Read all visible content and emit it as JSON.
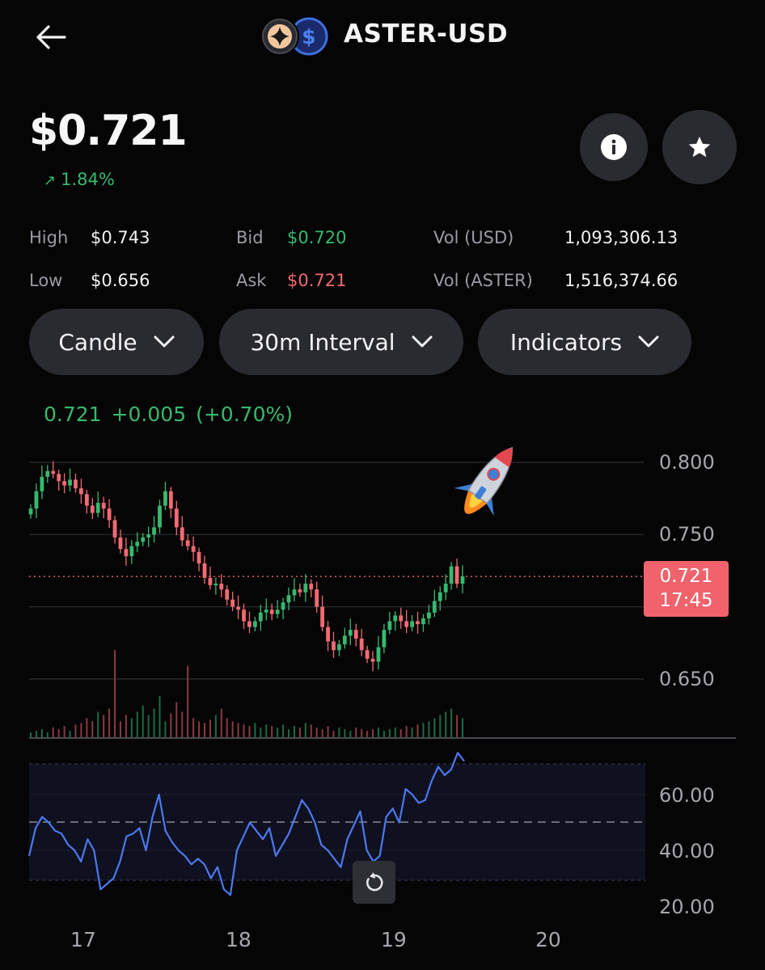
{
  "header": {
    "pair": "ASTER-USD",
    "back_icon": "arrow-left-icon",
    "coin_icons": [
      "aster-logo-icon",
      "usd-coin-icon"
    ]
  },
  "price": {
    "value": "$0.721",
    "change": "1.84%",
    "change_icon": "arrow-up-right-icon",
    "change_color": "#37b96e"
  },
  "actions": {
    "info_icon": "info-icon",
    "favorite_icon": "star-icon"
  },
  "stats": {
    "high_label": "High",
    "high_value": "$0.743",
    "low_label": "Low",
    "low_value": "$0.656",
    "bid_label": "Bid",
    "bid_value": "$0.720",
    "ask_label": "Ask",
    "ask_value": "$0.721",
    "vol_usd_label": "Vol (USD)",
    "vol_usd_value": "1,093,306.13",
    "vol_aster_label": "Vol (ASTER)",
    "vol_aster_value": "1,516,374.66"
  },
  "controls": {
    "chart_type": "Candle",
    "interval": "30m Interval",
    "indicators": "Indicators"
  },
  "quote": {
    "last": "0.721",
    "change_abs": "+0.005",
    "change_pct": "(+0.70%)"
  },
  "colors": {
    "up": "#37b96e",
    "down": "#f26a72",
    "price_tag": "#f0636c",
    "background": "#050506"
  },
  "chart_data": [
    {
      "type": "candlestick",
      "y_ticks": [
        "0.800",
        "0.750",
        "0.650"
      ],
      "ylim": [
        0.63,
        0.81
      ],
      "x_ticks": [
        "17",
        "18",
        "19",
        "20"
      ],
      "current_price_tag": {
        "price": "0.721",
        "countdown": "17:45"
      },
      "decoration": "rocket-emoji",
      "close_series": [
        0.768,
        0.78,
        0.79,
        0.794,
        0.792,
        0.787,
        0.784,
        0.788,
        0.782,
        0.778,
        0.77,
        0.765,
        0.772,
        0.768,
        0.76,
        0.748,
        0.74,
        0.735,
        0.742,
        0.745,
        0.748,
        0.75,
        0.755,
        0.77,
        0.78,
        0.768,
        0.755,
        0.746,
        0.742,
        0.738,
        0.73,
        0.72,
        0.715,
        0.716,
        0.712,
        0.705,
        0.7,
        0.698,
        0.69,
        0.686,
        0.69,
        0.696,
        0.698,
        0.695,
        0.698,
        0.703,
        0.708,
        0.712,
        0.71,
        0.716,
        0.712,
        0.7,
        0.686,
        0.676,
        0.67,
        0.674,
        0.68,
        0.684,
        0.678,
        0.67,
        0.664,
        0.662,
        0.672,
        0.684,
        0.69,
        0.694,
        0.69,
        0.686,
        0.69,
        0.688,
        0.692,
        0.696,
        0.704,
        0.71,
        0.716,
        0.728,
        0.716,
        0.721
      ],
      "volumes": [
        3,
        4,
        5,
        3,
        6,
        5,
        7,
        4,
        8,
        9,
        12,
        10,
        16,
        14,
        18,
        55,
        10,
        14,
        12,
        16,
        20,
        14,
        18,
        26,
        10,
        15,
        22,
        16,
        45,
        12,
        10,
        9,
        11,
        14,
        18,
        12,
        10,
        9,
        8,
        7,
        9,
        6,
        8,
        7,
        6,
        8,
        5,
        7,
        6,
        9,
        8,
        6,
        5,
        7,
        4,
        6,
        5,
        4,
        6,
        5,
        4,
        5,
        6,
        4,
        5,
        6,
        5,
        7,
        6,
        8,
        9,
        10,
        12,
        14,
        16,
        18,
        14,
        12
      ]
    },
    {
      "type": "line",
      "name": "RSI",
      "y_ticks": [
        "60.00",
        "40.00",
        "20.00"
      ],
      "ylim": [
        20,
        80
      ],
      "reference_line": 50,
      "band": [
        30,
        70
      ],
      "values": [
        38,
        48,
        52,
        50,
        47,
        46,
        42,
        40,
        36,
        44,
        40,
        26,
        28,
        30,
        36,
        45,
        46,
        48,
        40,
        52,
        60,
        47,
        43,
        40,
        38,
        35,
        37,
        35,
        30,
        34,
        26,
        24,
        40,
        45,
        50,
        47,
        44,
        48,
        38,
        42,
        46,
        52,
        58,
        55,
        50,
        42,
        40,
        37,
        34,
        44,
        49,
        54,
        40,
        36,
        38,
        52,
        55,
        50,
        62,
        60,
        57,
        58,
        65,
        70,
        67,
        69,
        75,
        72
      ]
    }
  ],
  "reset_icon": "reset-zoom-icon"
}
